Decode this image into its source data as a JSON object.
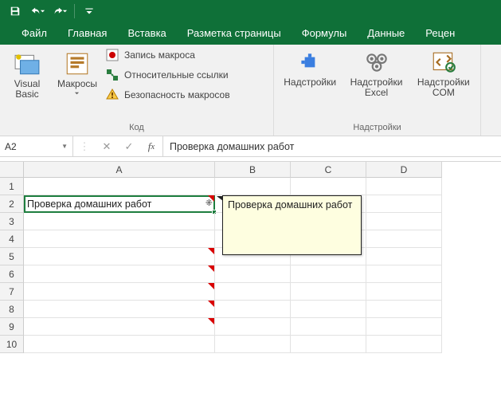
{
  "tabs": {
    "file": "Файл",
    "home": "Главная",
    "insert": "Вставка",
    "layout": "Разметка страницы",
    "formulas": "Формулы",
    "data": "Данные",
    "review": "Рецен"
  },
  "ribbon": {
    "code_group": {
      "visual_basic": "Visual\nBasic",
      "macros": "Макросы",
      "record": "Запись макроса",
      "relative": "Относительные ссылки",
      "security": "Безопасность макросов",
      "label": "Код"
    },
    "addins_group": {
      "addins": "Надстройки",
      "excel_addins": "Надстройки\nExcel",
      "com_addins": "Надстройки\nCOM",
      "label": "Надстройки"
    }
  },
  "formula_bar": {
    "cell_ref": "A2",
    "formula": "Проверка домашних работ"
  },
  "columns": {
    "A": "A",
    "B": "B",
    "C": "C",
    "D": "D"
  },
  "rows": [
    "1",
    "2",
    "3",
    "4",
    "5",
    "6",
    "7",
    "8",
    "9",
    "10"
  ],
  "cells": {
    "A2": "Проверка домашних работ"
  },
  "note_text": "Проверка домашних работ"
}
